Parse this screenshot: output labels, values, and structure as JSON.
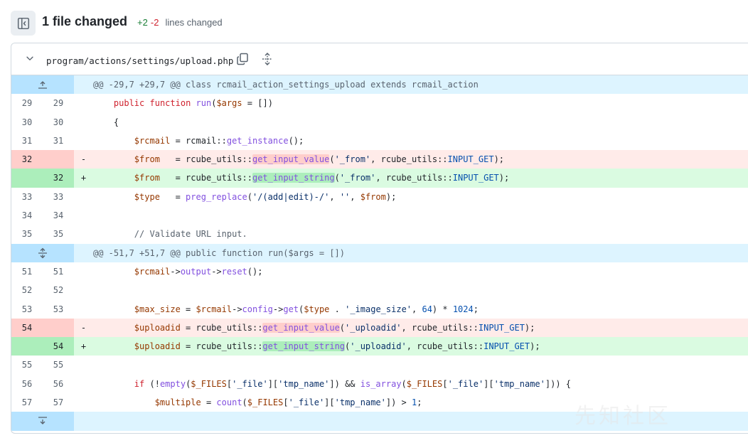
{
  "summary": {
    "title": "1 file changed",
    "additions": "+2",
    "deletions": "-2",
    "lines_label": "lines changed"
  },
  "file": {
    "path": "program/actions/settings/upload.php"
  },
  "hunks": [
    "@@ -29,7 +29,7 @@ class rcmail_action_settings_upload extends rcmail_action",
    "@@ -51,7 +51,7 @@ public function run($args = [])"
  ],
  "lines": [
    {
      "l": "29",
      "r": "29",
      "s": "",
      "t": "ctx",
      "code": "    public function run($args = [])"
    },
    {
      "l": "30",
      "r": "30",
      "s": "",
      "t": "ctx",
      "code": "    {"
    },
    {
      "l": "31",
      "r": "31",
      "s": "",
      "t": "ctx",
      "code": "        $rcmail = rcmail::get_instance();"
    },
    {
      "l": "32",
      "r": "",
      "s": "-",
      "t": "del",
      "code": "        $from   = rcube_utils::get_input_value('_from', rcube_utils::INPUT_GET);"
    },
    {
      "l": "",
      "r": "32",
      "s": "+",
      "t": "add",
      "code": "        $from   = rcube_utils::get_input_string('_from', rcube_utils::INPUT_GET);"
    },
    {
      "l": "33",
      "r": "33",
      "s": "",
      "t": "ctx",
      "code": "        $type   = preg_replace('/(add|edit)-/', '', $from);"
    },
    {
      "l": "34",
      "r": "34",
      "s": "",
      "t": "ctx",
      "code": ""
    },
    {
      "l": "35",
      "r": "35",
      "s": "",
      "t": "ctx",
      "code": "        // Validate URL input."
    },
    {
      "l": "51",
      "r": "51",
      "s": "",
      "t": "ctx",
      "code": "        $rcmail->output->reset();"
    },
    {
      "l": "52",
      "r": "52",
      "s": "",
      "t": "ctx",
      "code": ""
    },
    {
      "l": "53",
      "r": "53",
      "s": "",
      "t": "ctx",
      "code": "        $max_size = $rcmail->config->get($type . '_image_size', 64) * 1024;"
    },
    {
      "l": "54",
      "r": "",
      "s": "-",
      "t": "del",
      "code": "        $uploadid = rcube_utils::get_input_value('_uploadid', rcube_utils::INPUT_GET);"
    },
    {
      "l": "",
      "r": "54",
      "s": "+",
      "t": "add",
      "code": "        $uploadid = rcube_utils::get_input_string('_uploadid', rcube_utils::INPUT_GET);"
    },
    {
      "l": "55",
      "r": "55",
      "s": "",
      "t": "ctx",
      "code": ""
    },
    {
      "l": "56",
      "r": "56",
      "s": "",
      "t": "ctx",
      "code": "        if (!empty($_FILES['_file']['tmp_name']) && is_array($_FILES['_file']['tmp_name'])) {"
    },
    {
      "l": "57",
      "r": "57",
      "s": "",
      "t": "ctx",
      "code": "            $multiple = count($_FILES['_file']['tmp_name']) > 1;"
    }
  ],
  "watermark": "先知社区",
  "icons": {
    "toggle": "sidebar-toggle-icon",
    "chevron": "chevron-down-icon",
    "copy": "copy-icon",
    "expand": "unfold-icon"
  }
}
